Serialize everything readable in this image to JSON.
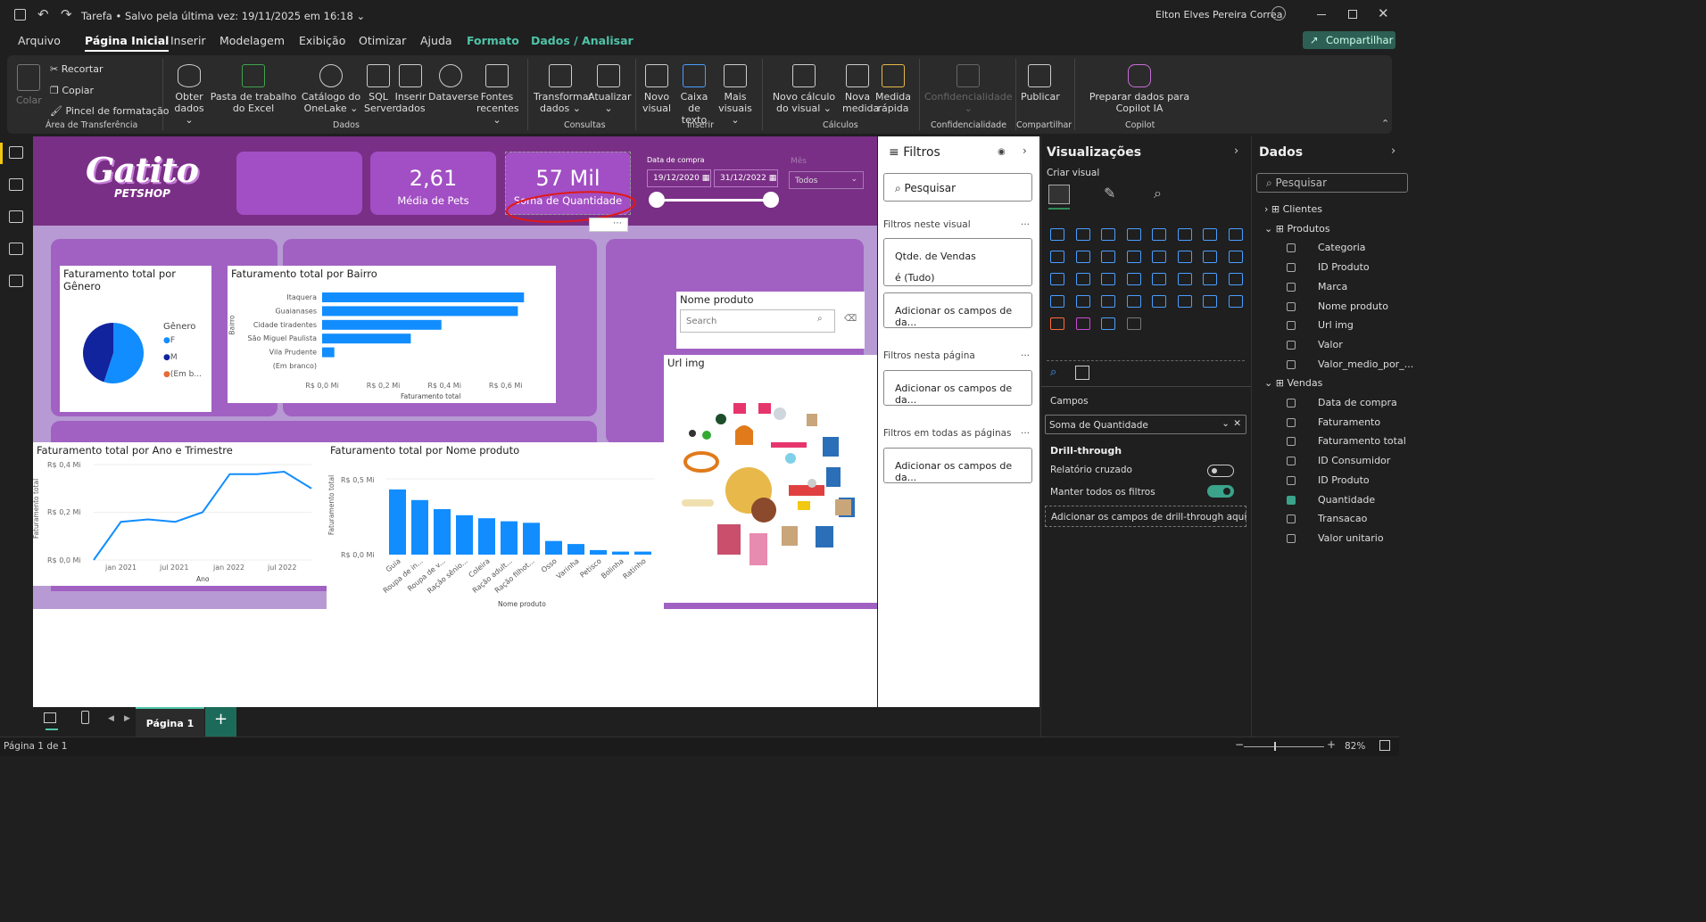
{
  "window": {
    "file_name": "Tarefa",
    "save_status": "Salvo pela última vez: 19/11/2025 em 16:18",
    "user_name": "Elton Elves Pereira Correa"
  },
  "menu": {
    "tabs": [
      "Arquivo",
      "Página Inicial",
      "Inserir",
      "Modelagem",
      "Exibição",
      "Otimizar",
      "Ajuda",
      "Formato",
      "Dados / Analisar"
    ],
    "active": "Página Inicial",
    "share": "Compartilhar"
  },
  "ribbon": {
    "clipboard": {
      "paste": "Colar",
      "cut": "Recortar",
      "copy": "Copiar",
      "format_painter": "Pincel de formatação",
      "group": "Área de Transferência"
    },
    "data": {
      "get_data": "Obter dados",
      "excel": "Pasta de trabalho do Excel",
      "onelake": "Catálogo do OneLake",
      "sql": "SQL Server",
      "enter": "Inserir dados",
      "dataverse": "Dataverse",
      "recent": "Fontes recentes",
      "group": "Dados"
    },
    "queries": {
      "transform": "Transformar dados",
      "refresh": "Atualizar",
      "group": "Consultas"
    },
    "insert": {
      "new_visual": "Novo visual",
      "textbox": "Caixa de texto",
      "more": "Mais visuais",
      "group": "Inserir"
    },
    "calc": {
      "new_calc": "Novo cálculo do visual",
      "new_measure": "Nova medida",
      "quick": "Medida rápida",
      "group": "Cálculos"
    },
    "sens": {
      "label": "Confidencialidade",
      "group": "Confidencialidade"
    },
    "share": {
      "publish": "Publicar",
      "group": "Compartilhar"
    },
    "copilot": {
      "prepare": "Preparar dados para Copilot IA",
      "group": "Copilot"
    }
  },
  "report": {
    "logo": {
      "brand": "Gatito",
      "sub": "PETSHOP"
    },
    "kpis": [
      {
        "value": "",
        "label": ""
      },
      {
        "value": "2,61",
        "label": "Média de Pets"
      },
      {
        "value": "57 Mil",
        "label": "Soma de Quantidade"
      }
    ],
    "date_slicer": {
      "title": "Data de compra",
      "start": "19/12/2020",
      "end": "31/12/2022"
    },
    "mes_slicer": {
      "title": "Mês",
      "value": "Todos"
    },
    "pie": {
      "title": "Faturamento total por Gênero",
      "legend_title": "Gênero",
      "legend": [
        "F",
        "M",
        "(Em b..."
      ]
    },
    "bairro": {
      "title": "Faturamento total por Bairro",
      "ylabel": "Bairro",
      "xlabel": "Faturamento total",
      "ticks": [
        "R$ 0,0 Mi",
        "R$ 0,2 Mi",
        "R$ 0,4 Mi",
        "R$ 0,6 Mi"
      ]
    },
    "nome_slicer": {
      "title": "Nome produto",
      "placeholder": "Search"
    },
    "url_img": {
      "title": "Url img"
    },
    "line": {
      "title": "Faturamento total por Ano e Trimestre",
      "ylabel": "Faturamento total",
      "xlabel": "Ano",
      "yticks": [
        "R$ 0,4 Mi",
        "R$ 0,2 Mi",
        "R$ 0,0 Mi"
      ],
      "xticks": [
        "jan 2021",
        "jul 2021",
        "jan 2022",
        "jul 2022"
      ]
    },
    "prod": {
      "title": "Faturamento total por Nome produto",
      "ylabel": "Faturamento total",
      "xlabel": "Nome produto",
      "yticks": [
        "R$ 0,5 Mi",
        "R$ 0,0 Mi"
      ]
    }
  },
  "chart_data": [
    {
      "type": "pie",
      "title": "Faturamento total por Gênero",
      "categories": [
        "F",
        "M",
        "(Em b..."
      ],
      "values": [
        55,
        45,
        0
      ],
      "colors": [
        "#118dff",
        "#12239e",
        "#e66c37"
      ]
    },
    {
      "type": "bar",
      "title": "Faturamento total por Bairro",
      "categories": [
        "Itaquera",
        "Guaianases",
        "Cidade tiradentes",
        "São Miguel Paulista",
        "Vila Prudente",
        "(Em branco)"
      ],
      "values": [
        0.66,
        0.64,
        0.39,
        0.29,
        0.04,
        0.0
      ],
      "xlim": [
        0,
        0.7
      ],
      "xlabel": "Faturamento total",
      "ylabel": "Bairro"
    },
    {
      "type": "line",
      "title": "Faturamento total por Ano e Trimestre",
      "x": [
        "2020-Q4",
        "2021-Q1",
        "2021-Q2",
        "2021-Q3",
        "2021-Q4",
        "2022-Q1",
        "2022-Q2",
        "2022-Q3",
        "2022-Q4"
      ],
      "values": [
        0.0,
        0.16,
        0.17,
        0.16,
        0.2,
        0.36,
        0.36,
        0.37,
        0.3
      ],
      "ylim": [
        0,
        0.4
      ],
      "xlabel": "Ano",
      "ylabel": "Faturamento total"
    },
    {
      "type": "bar",
      "title": "Faturamento total por Nome produto",
      "categories": [
        "Guia",
        "Roupa de in...",
        "Roupa de v...",
        "Ração sênio...",
        "Coleira",
        "Ração adult...",
        "Ração filhot...",
        "Osso",
        "Varinha",
        "Petisco",
        "Bolinha",
        "Ratinho"
      ],
      "values": [
        0.43,
        0.36,
        0.3,
        0.26,
        0.24,
        0.22,
        0.21,
        0.09,
        0.07,
        0.03,
        0.02,
        0.02
      ],
      "ylim": [
        0,
        0.5
      ],
      "xlabel": "Nome produto",
      "ylabel": "Faturamento total"
    }
  ],
  "page_tabs": {
    "page": "Página 1",
    "status": "Página 1 de 1",
    "zoom": "82%"
  },
  "filters": {
    "title": "Filtros",
    "search": "Pesquisar",
    "visual_section": "Filtros neste visual",
    "visual_field": "Qtde. de Vendas",
    "visual_value": "é (Tudo)",
    "add": "Adicionar os campos de da...",
    "page_section": "Filtros nesta página",
    "all_section": "Filtros em todas as páginas"
  },
  "viz": {
    "title": "Visualizações",
    "create": "Criar visual",
    "fields_label": "Campos",
    "field_value": "Soma de Quantidade",
    "drill": "Drill-through",
    "cross": "Relatório cruzado",
    "keep": "Manter todos os filtros",
    "drill_add": "Adicionar os campos de drill-through aqui"
  },
  "data_pane": {
    "title": "Dados",
    "search": "Pesquisar",
    "tables": [
      {
        "name": "Clientes",
        "expanded": false,
        "fields": []
      },
      {
        "name": "Produtos",
        "expanded": true,
        "fields": [
          "Categoria",
          "ID Produto",
          "Marca",
          "Nome produto",
          "Url img",
          "Valor",
          "Valor_medio_por_..."
        ]
      },
      {
        "name": "Vendas",
        "expanded": true,
        "fields": [
          "Data de compra",
          "Faturamento",
          "Faturamento total",
          "ID Consumidor",
          "ID Produto",
          "Quantidade",
          "Transacao",
          "Valor unitario"
        ]
      }
    ],
    "checked": "Quantidade"
  }
}
